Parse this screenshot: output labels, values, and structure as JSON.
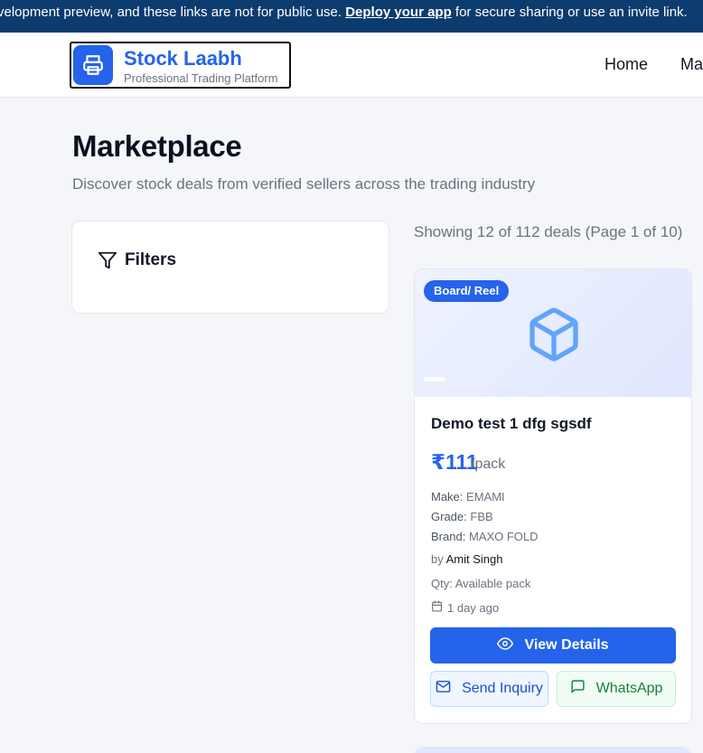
{
  "banner": {
    "text_before": "velopment preview, and these links are not for public use. ",
    "link": "Deploy your app",
    "text_after": " for secure sharing or use an invite link."
  },
  "brand": {
    "name": "Stock Laabh",
    "tagline": "Professional Trading Platform"
  },
  "nav": {
    "home": "Home",
    "marketplace": "Ma"
  },
  "page": {
    "title": "Marketplace",
    "subtitle": "Discover stock deals from verified sellers across the trading industry"
  },
  "filters": {
    "label": "Filters"
  },
  "results": {
    "showing": "Showing 12 of 112 deals (Page 1 of 10)"
  },
  "deal": {
    "badge": "Board/ Reel",
    "title": "Demo test 1 dfg sgsdf",
    "price": "₹111",
    "price_unit": "/pack",
    "make_label": "Make:",
    "make": "EMAMI",
    "grade_label": "Grade:",
    "grade": "FBB",
    "brand_label": "Brand:",
    "brand": "MAXO FOLD",
    "by_label": "by",
    "seller": "Amit Singh",
    "qty": "Qty: Available pack",
    "posted": "1 day ago",
    "view_details": "View Details",
    "send_inquiry": "Send Inquiry",
    "whatsapp": "WhatsApp"
  },
  "colors": {
    "primary": "#2563eb",
    "banner": "#0c3c6e",
    "whatsapp": "#15803d"
  }
}
